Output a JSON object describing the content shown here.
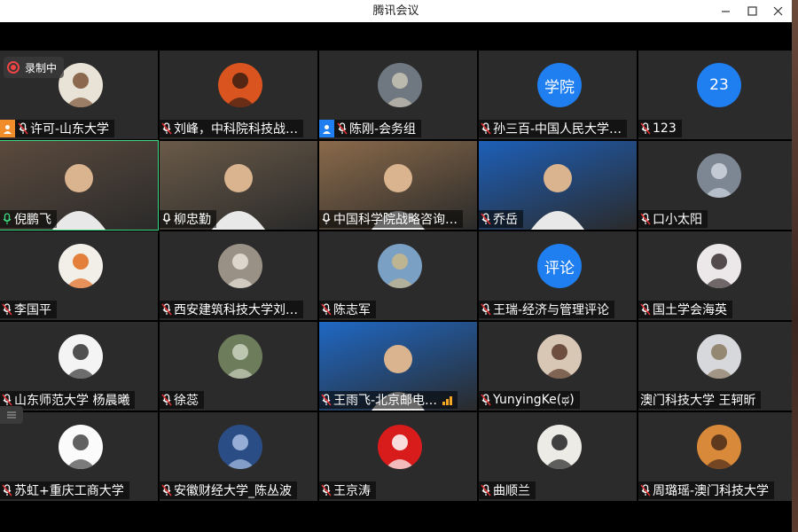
{
  "window": {
    "title": "腾讯会议"
  },
  "recording": {
    "label": "录制中"
  },
  "colors": {
    "mic_red": "#e03131",
    "avatar_blue": "#1f7ef0",
    "host_orange": "#f08c2a",
    "host_blue": "#1f7ef0"
  },
  "participants": [
    {
      "name": "许可-山东大学",
      "host": "orange",
      "mic": "muted",
      "kind": "avatar",
      "avatar_bg": "#e9e2d6",
      "avatar_fg": "#7a5236"
    },
    {
      "name": "刘峰，中科院科技战…",
      "mic": "muted",
      "kind": "avatar",
      "avatar_bg": "#d9541e",
      "avatar_fg": "#3b1d12"
    },
    {
      "name": "陈刚-会务组",
      "host": "blue",
      "mic": "muted",
      "kind": "avatar",
      "avatar_bg": "#6f7780",
      "avatar_fg": "#c9c3b5"
    },
    {
      "name": "孙三百-中国人民大学…",
      "mic": "muted",
      "kind": "text",
      "avatar_text": "学院"
    },
    {
      "name": "123",
      "mic": "muted",
      "kind": "text",
      "avatar_text": "23"
    },
    {
      "name": "倪鹏飞",
      "mic": "active",
      "kind": "video",
      "video_bg": "#5b4a3d"
    },
    {
      "name": "柳忠勤",
      "mic": "on",
      "kind": "video",
      "video_bg": "#6a5a48"
    },
    {
      "name": "中国科学院战略咨询…",
      "mic": "on",
      "kind": "video",
      "video_bg": "#8a6a4a"
    },
    {
      "name": "乔岳",
      "mic": "muted",
      "kind": "video",
      "video_bg": "#1d5fb8"
    },
    {
      "name": "口小太阳",
      "mic": "muted",
      "kind": "avatar",
      "avatar_bg": "#7d8794",
      "avatar_fg": "#cfd6df"
    },
    {
      "name": "李国平",
      "mic": "muted",
      "kind": "avatar",
      "avatar_bg": "#f2efe8",
      "avatar_fg": "#e06a1c"
    },
    {
      "name": "西安建筑科技大学刘…",
      "mic": "muted",
      "kind": "avatar",
      "avatar_bg": "#9a9186",
      "avatar_fg": "#e8e2d8"
    },
    {
      "name": "陈志军",
      "mic": "muted",
      "kind": "avatar",
      "avatar_bg": "#7aa0c4",
      "avatar_fg": "#c9b88a"
    },
    {
      "name": "王瑞-经济与管理评论",
      "mic": "muted",
      "kind": "text",
      "avatar_text": "评论"
    },
    {
      "name": "国土学会海英",
      "mic": "muted",
      "kind": "avatar",
      "avatar_bg": "#ece8ea",
      "avatar_fg": "#3a3030"
    },
    {
      "name": "山东师范大学 杨晨曦",
      "mic": "muted",
      "kind": "avatar",
      "avatar_bg": "#f4f4f4",
      "avatar_fg": "#333333"
    },
    {
      "name": "徐蕊",
      "mic": "muted",
      "kind": "avatar",
      "avatar_bg": "#6d7d5c",
      "avatar_fg": "#cbd2bf"
    },
    {
      "name": "王雨飞-北京邮电…",
      "mic": "muted",
      "kind": "video",
      "video_bg": "#1f68c4",
      "signal": true
    },
    {
      "name": "YunyingKe(ಥ)",
      "mic": "muted",
      "kind": "avatar",
      "avatar_bg": "#d9c7b6",
      "avatar_fg": "#5a3a2a"
    },
    {
      "name": "澳门科技大学 王轲昕",
      "mic": "none",
      "kind": "avatar",
      "avatar_bg": "#d6d8dc",
      "avatar_fg": "#8a7a60"
    },
    {
      "name": "苏虹+重庆工商大学",
      "mic": "muted",
      "kind": "avatar",
      "avatar_bg": "#fbfbfb",
      "avatar_fg": "#444444"
    },
    {
      "name": "安徽财经大学_陈丛波",
      "mic": "muted",
      "kind": "avatar",
      "avatar_bg": "#2b4d86",
      "avatar_fg": "#a9c0e4"
    },
    {
      "name": "王京涛",
      "mic": "muted",
      "kind": "avatar",
      "avatar_bg": "#d81b1b",
      "avatar_fg": "#ffffff"
    },
    {
      "name": "曲顺兰",
      "mic": "muted",
      "kind": "avatar",
      "avatar_bg": "#ecebe6",
      "avatar_fg": "#222222"
    },
    {
      "name": "周璐瑶-澳门科技大学",
      "mic": "muted",
      "kind": "avatar",
      "avatar_bg": "#d88a3a",
      "avatar_fg": "#4a2a1a"
    }
  ]
}
